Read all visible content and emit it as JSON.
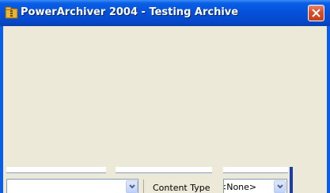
{
  "window": {
    "title": "PowerArchiver 2004 - Testing Archive",
    "app_icon": "archive-folder-icon",
    "close_icon": "close-icon"
  },
  "filters": {
    "content_type_label": "Content Type",
    "content_type_value": "<None>",
    "left_combo_value": "",
    "middle_combo_value": ""
  },
  "colors": {
    "title_bar": "#0550d8",
    "window_bg": "#ece9d8",
    "close_button": "#d8512e",
    "accent_bar": "#1c3ca6"
  }
}
